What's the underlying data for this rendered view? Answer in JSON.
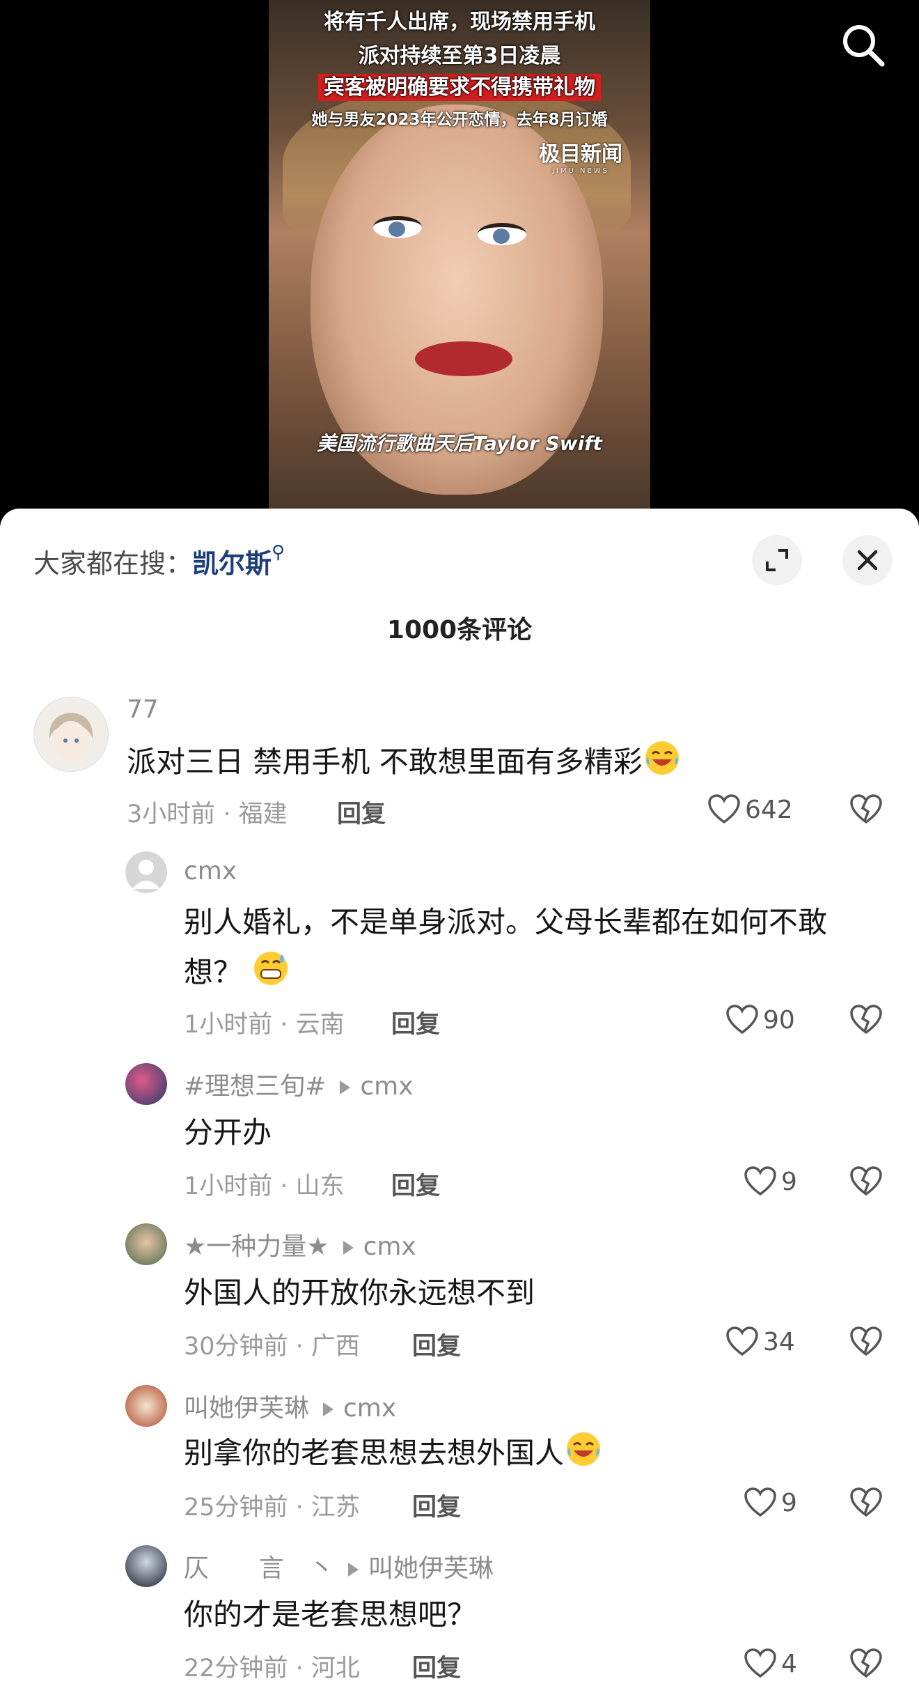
{
  "video": {
    "overlay_lines": [
      "将有千人出席，现场禁用手机",
      "派对持续至第3日凌晨",
      "宾客被明确要求不得携带礼物",
      "她与男友2023年公开恋情，去年8月订婚"
    ],
    "watermark": "极目新闻",
    "watermark_sub": "JIMU NEWS",
    "caption": "美国流行歌曲天后Taylor Swift"
  },
  "sheet": {
    "hot_search_prefix": "大家都在搜：",
    "hot_search_keyword": "凯尔斯",
    "comment_count_title": "1000条评论"
  },
  "comments": [
    {
      "user": "77",
      "reply_to": "",
      "text": "派对三日 禁用手机 不敢想里面有多精彩",
      "time_location": "3小时前 · 福建",
      "reply_label": "回复",
      "likes": "642"
    },
    {
      "user": "cmx",
      "reply_to": "",
      "text": "别人婚礼，不是单身派对。父母长辈都在如何不敢想？",
      "time_location": "1小时前 · 云南",
      "reply_label": "回复",
      "likes": "90"
    },
    {
      "user": "#理想三旬#",
      "reply_to": "cmx",
      "text": "分开办",
      "time_location": "1小时前 · 山东",
      "reply_label": "回复",
      "likes": "9"
    },
    {
      "user": "★一种力量★",
      "reply_to": "cmx",
      "text": "外国人的开放你永远想不到",
      "time_location": "30分钟前 · 广西",
      "reply_label": "回复",
      "likes": "34"
    },
    {
      "user": "叫她伊芙琳",
      "reply_to": "cmx",
      "text": "别拿你的老套思想去想外国人",
      "time_location": "25分钟前 · 江苏",
      "reply_label": "回复",
      "likes": "9"
    },
    {
      "user": "仄　　言　丶",
      "reply_to": "叫她伊芙琳",
      "text": "你的才是老套思想吧？",
      "time_location": "22分钟前 · 河北",
      "reply_label": "回复",
      "likes": "4"
    }
  ],
  "icons": {
    "search": "search-icon",
    "expand": "expand-icon",
    "close": "close-icon",
    "like": "heart-icon",
    "dislike": "broken-heart-icon",
    "emoji_laugh_cry": "laugh-cry-emoji",
    "emoji_sweat": "sweat-smile-emoji"
  },
  "colors": {
    "keyword": "#1e3e7a",
    "meta": "#9a9a9a",
    "overlay_highlight": "#d11f1f"
  }
}
